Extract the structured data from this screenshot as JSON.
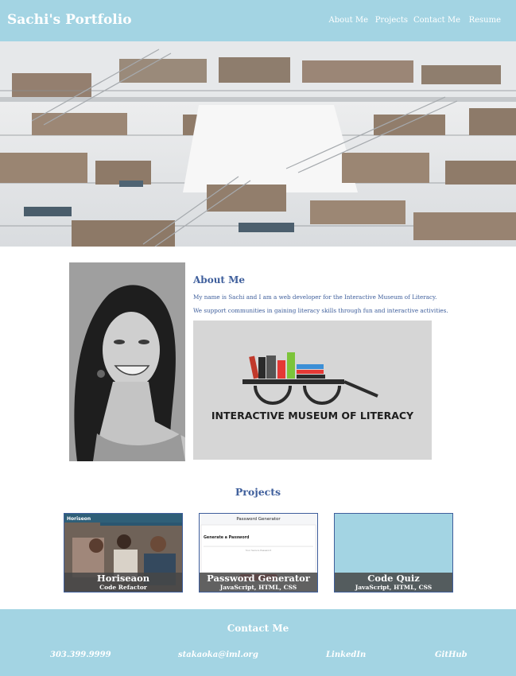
{
  "header": {
    "title": "Sachi's Portfolio",
    "nav": [
      "About Me",
      "Projects",
      "Contact Me",
      "Resume"
    ]
  },
  "hero": {
    "image": "library-atrium-image"
  },
  "about": {
    "heading": "About Me",
    "lines": [
      "My name is Sachi and I am a web developer for the Interactive Museum of Literacy.",
      "We support communities in gaining literacy skills through fun and interactive activities."
    ],
    "logo_text": "INTERACTIVE MUSEUM OF LITERACY"
  },
  "projects": {
    "heading": "Projects",
    "cards": [
      {
        "title": "Horiseaon",
        "subtitle": "Code Refactor",
        "thumb_brand": "Horiseon"
      },
      {
        "title": "Password Generator",
        "subtitle": "JavaScript, HTML, CSS",
        "thumb_title": "Password Generator",
        "thumb_label": "Generate a Password",
        "thumb_placeholder": "Your Secure Password"
      },
      {
        "title": "Code Quiz",
        "subtitle": "JavaScript, HTML, CSS"
      }
    ]
  },
  "contact": {
    "heading": "Contact Me",
    "phone": "303.399.9999",
    "email": "stakaoka@iml.org",
    "linkedin": "LinkedIn",
    "github": "GitHub"
  },
  "colors": {
    "header_bg": "#a3d4e3",
    "accent_text": "#3f5f9c",
    "footer_bg": "#a3d4e3"
  }
}
